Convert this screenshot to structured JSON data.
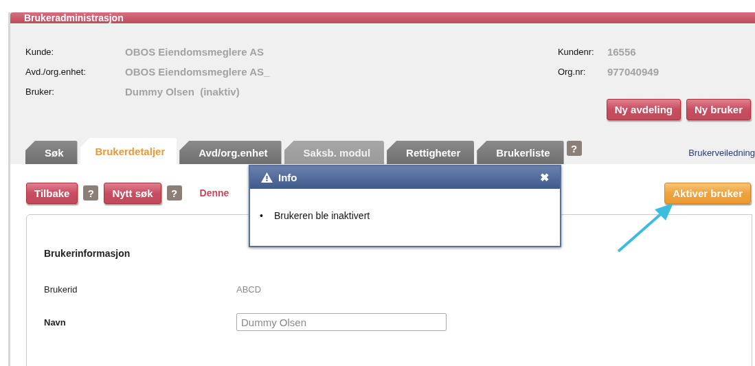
{
  "panel": {
    "title": "Brukeradministrasjon"
  },
  "info_left": [
    {
      "label": "Kunde:",
      "value": "OBOS Eiendomsmeglere AS"
    },
    {
      "label": "Avd./org.enhet:",
      "value": "OBOS Eiendomsmeglere AS_"
    },
    {
      "label": "Bruker:",
      "value": "Dummy Olsen  (inaktiv)"
    }
  ],
  "info_right": [
    {
      "label": "Kundenr:",
      "value": "16556"
    },
    {
      "label": "Org.nr:",
      "value": "977040949"
    }
  ],
  "top_buttons": [
    "Ny avdeling",
    "Ny bruker"
  ],
  "tabs": [
    {
      "label": "Søk",
      "selected": false,
      "disabled": false
    },
    {
      "label": "Brukerdetaljer",
      "selected": true,
      "disabled": false
    },
    {
      "label": "Avd/org.enhet",
      "selected": false,
      "disabled": false
    },
    {
      "label": "Saksb. modul",
      "selected": false,
      "disabled": true
    },
    {
      "label": "Rettigheter",
      "selected": false,
      "disabled": false
    },
    {
      "label": "Brukerliste",
      "selected": false,
      "disabled": false
    }
  ],
  "tabs_help": "?",
  "guide_link": "Brukerveiledning",
  "toolbar": [
    {
      "kind": "button",
      "label": "Tilbake"
    },
    {
      "kind": "help",
      "label": "?"
    },
    {
      "kind": "button",
      "label": "Nytt søk"
    },
    {
      "kind": "help",
      "label": "?"
    },
    {
      "kind": "message",
      "label": "Denne"
    }
  ],
  "activate_button": "Aktiver bruker",
  "dialog": {
    "title": "Info",
    "close": "✖",
    "items": [
      {
        "marker": "•",
        "text": "Brukeren ble inaktivert"
      }
    ]
  },
  "section": {
    "title": "Brukerinformasjon",
    "fields": [
      {
        "kind": "text",
        "label": "Brukerid",
        "value": "ABCD"
      },
      {
        "kind": "input",
        "label": "Navn",
        "value": "Dummy Olsen"
      }
    ]
  }
}
